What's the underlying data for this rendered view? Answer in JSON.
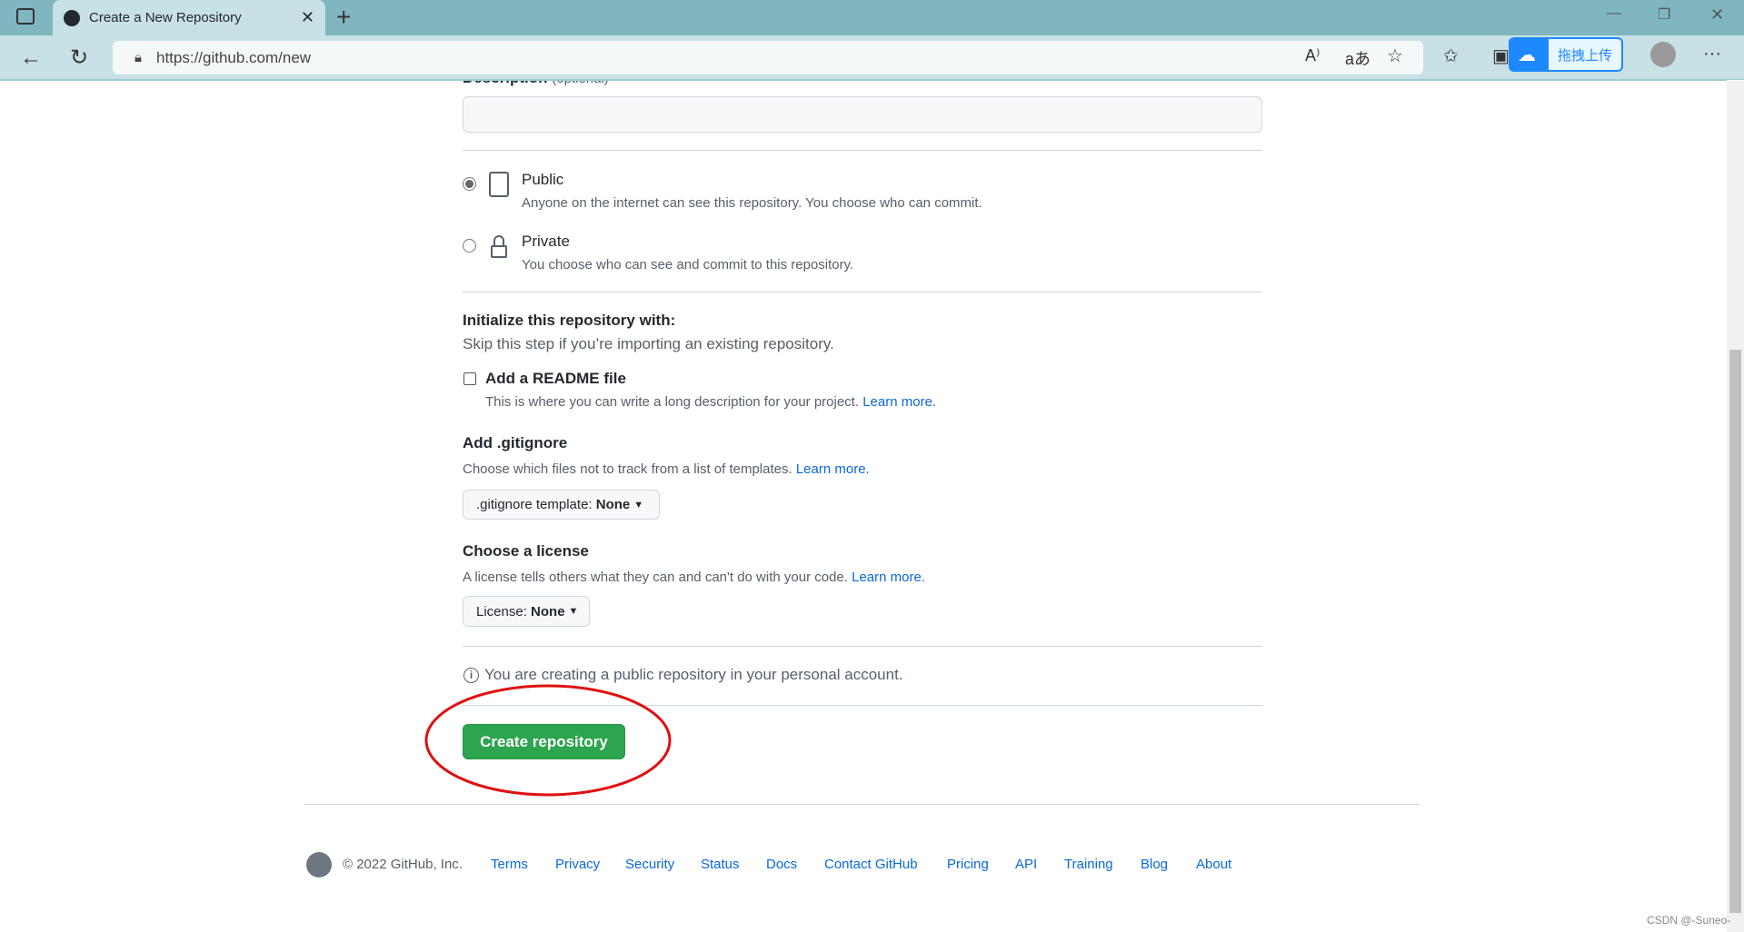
{
  "browser": {
    "tab_title": "Create a New Repository",
    "url": "https://github.com/new",
    "upload_label": "拖拽上传"
  },
  "form": {
    "description_label": "Description",
    "description_optional": "(optional)",
    "description_value": "",
    "visibility": [
      {
        "label": "Public",
        "desc": "Anyone on the internet can see this repository. You choose who can commit.",
        "selected": true
      },
      {
        "label": "Private",
        "desc": "You choose who can see and commit to this repository.",
        "selected": false
      }
    ],
    "init_title": "Initialize this repository with:",
    "init_sub": "Skip this step if you’re importing an existing repository.",
    "readme_label": "Add a README file",
    "readme_checked": false,
    "readme_desc": "This is where you can write a long description for your project.",
    "learn_more": "Learn more.",
    "gitignore_title": "Add .gitignore",
    "gitignore_desc": "Choose which files not to track from a list of templates.",
    "gitignore_btn_label": ".gitignore template:",
    "gitignore_value": "None",
    "license_title": "Choose a license",
    "license_desc": "A license tells others what they can and can't do with your code.",
    "license_btn_label": "License:",
    "license_value": "None",
    "info": "You are creating a public repository in your personal account.",
    "create_label": "Create repository"
  },
  "footer": {
    "copyright": "© 2022 GitHub, Inc.",
    "links": [
      "Terms",
      "Privacy",
      "Security",
      "Status",
      "Docs",
      "Contact GitHub",
      "Pricing",
      "API",
      "Training",
      "Blog",
      "About"
    ]
  },
  "watermark": "CSDN @-Suneo-",
  "colors": {
    "accent": "#2da44e",
    "link": "#0969da",
    "annotation": "#e01010"
  }
}
